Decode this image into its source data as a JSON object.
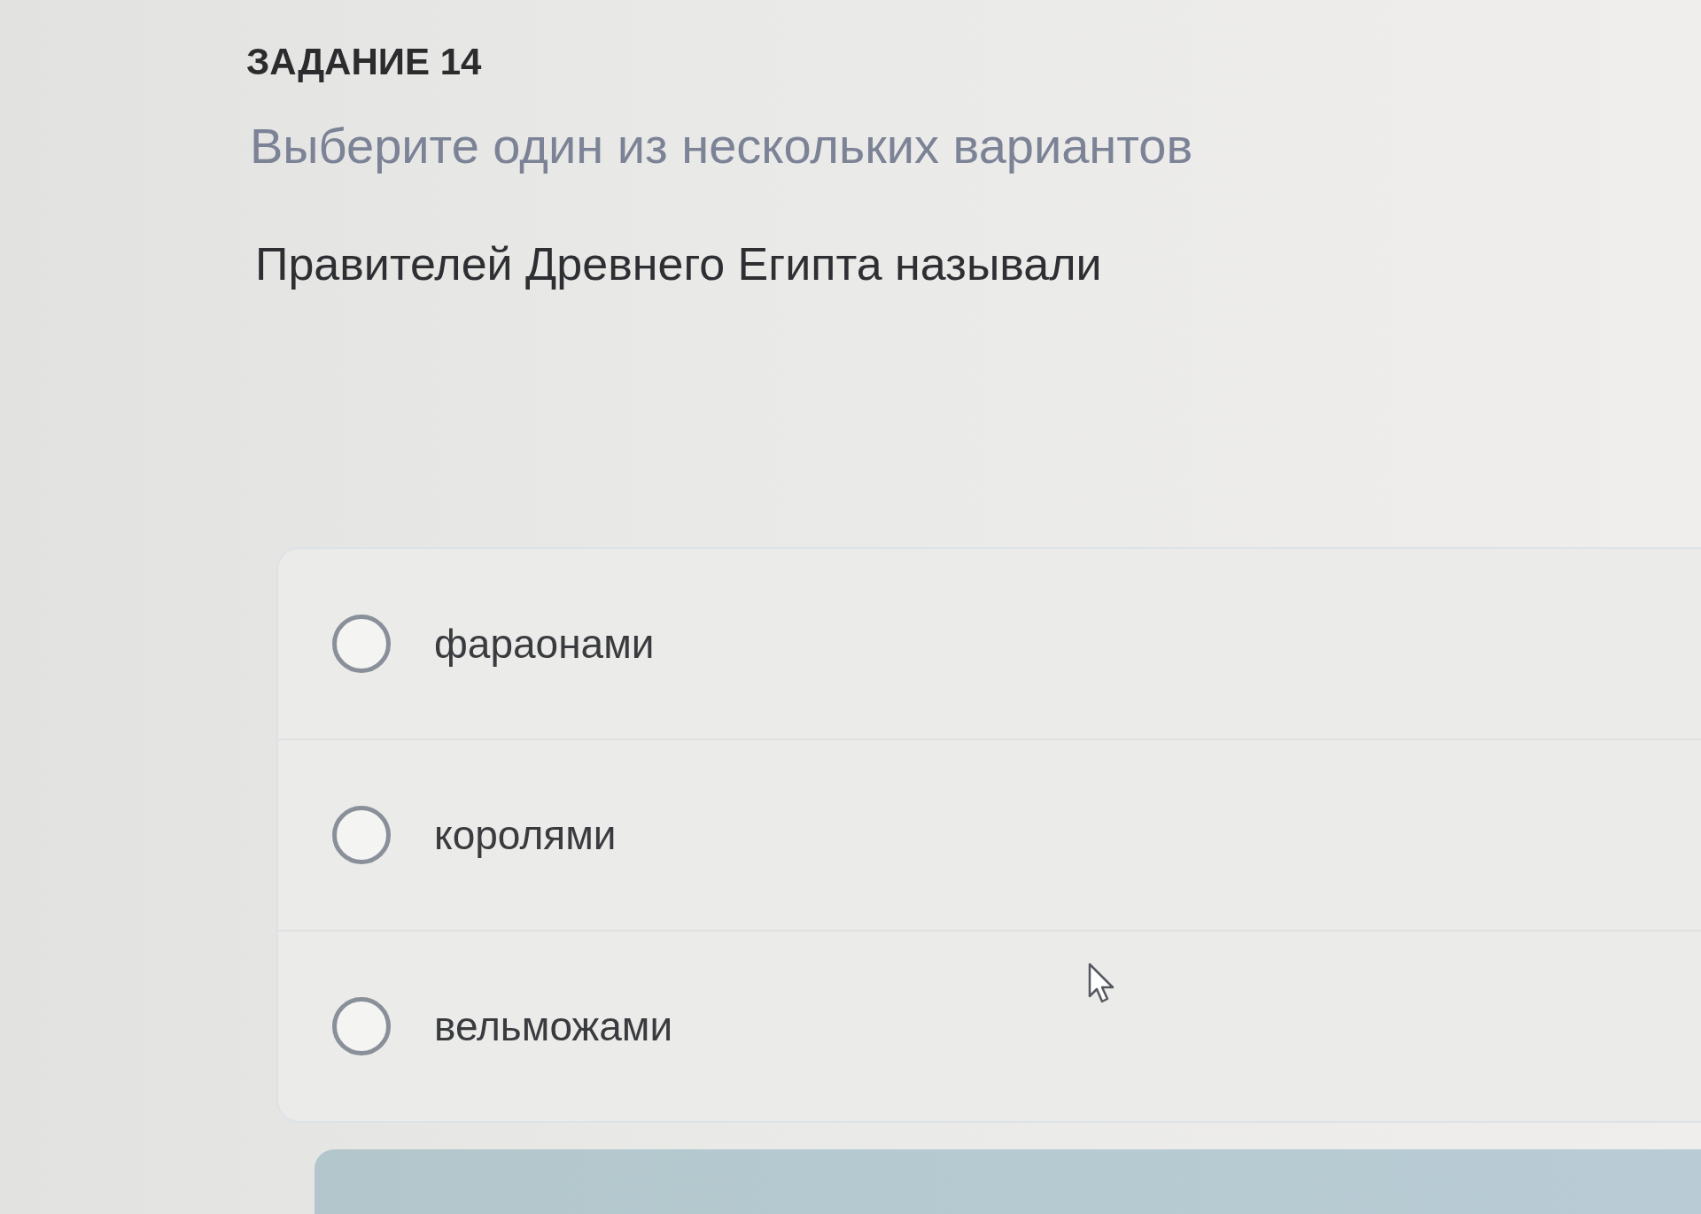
{
  "task": {
    "title": "ЗАДАНИЕ 14",
    "instruction": "Выберите один из нескольких вариантов",
    "question": "Правителей Древнего Египта называли"
  },
  "options": [
    {
      "label": "фараонами",
      "selected": false
    },
    {
      "label": "королями",
      "selected": false
    },
    {
      "label": "вельможами",
      "selected": false
    }
  ]
}
